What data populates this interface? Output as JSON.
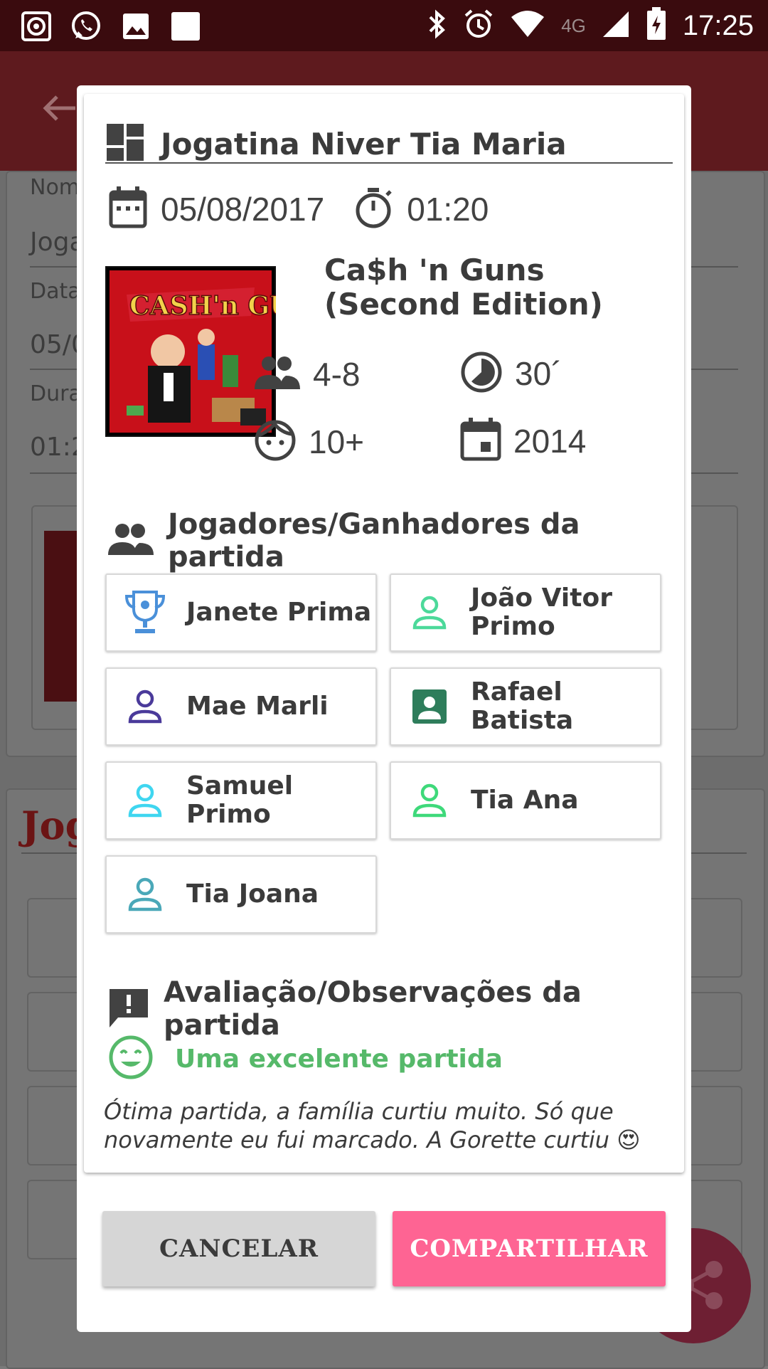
{
  "status_bar": {
    "time": "17:25",
    "network": "4G"
  },
  "background": {
    "labels": [
      "Nom",
      "Joga",
      "Data",
      "05/0",
      "Dura",
      "01:2"
    ],
    "section": "Jog"
  },
  "dialog": {
    "session_title": "Jogatina Niver Tia Maria",
    "date": "05/08/2017",
    "duration": "01:20",
    "game": {
      "name": "Ca$h 'n Guns (Second Edition)",
      "players": "4-8",
      "playtime": "30´",
      "age": "10+",
      "year": "2014",
      "cover_title": "CASH'n GUNS"
    },
    "players_section_title": "Jogadores/Ganhadores da partida",
    "players": [
      {
        "name": "Janete Prima",
        "icon": "trophy-icon",
        "color": "#4a90d9"
      },
      {
        "name": "João Vitor Primo",
        "icon": "person-outline-icon",
        "color": "#4cd99a"
      },
      {
        "name": "Mae Marli",
        "icon": "person-outline-icon",
        "color": "#4a3a9a"
      },
      {
        "name": "Rafael Batista",
        "icon": "contact-card-icon",
        "color": "#2e7d5b"
      },
      {
        "name": "Samuel Primo",
        "icon": "person-outline-icon",
        "color": "#3fd6f0"
      },
      {
        "name": "Tia Ana",
        "icon": "person-outline-icon",
        "color": "#3ed97a"
      },
      {
        "name": "Tia Joana",
        "icon": "person-outline-icon",
        "color": "#4aa8b8"
      }
    ],
    "review_section_title": "Avaliação/Observações da partida",
    "rating_text": "Uma excelente partida",
    "observation": "Ótima partida, a família curtiu muito. Só que novamente eu fui marcado. A Gorette curtiu 😍",
    "buttons": {
      "cancel": "CANCELAR",
      "share": "COMPARTILHAR"
    }
  },
  "colors": {
    "accent_pink": "#fe6493",
    "rating_green": "#56b96a",
    "app_bar": "#8b1a21"
  }
}
